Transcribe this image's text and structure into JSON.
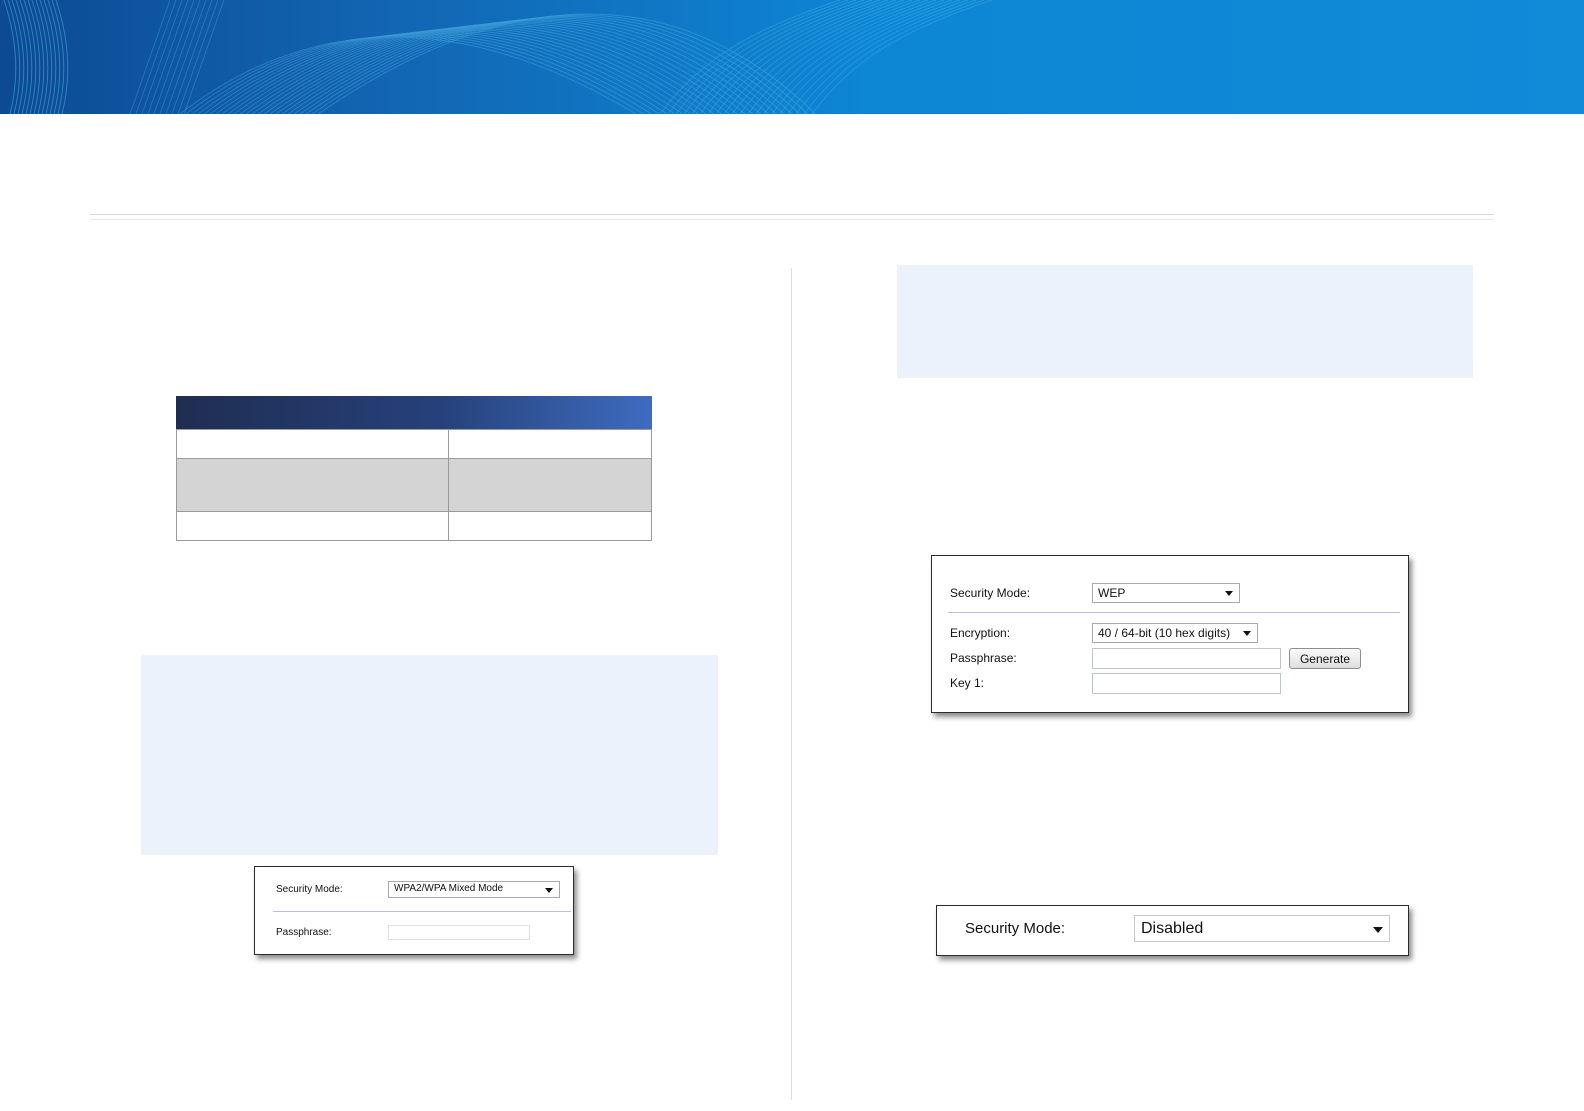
{
  "wpa_mixed_shot": {
    "security_mode_label": "Security Mode:",
    "security_mode_value": "WPA2/WPA Mixed Mode",
    "passphrase_label": "Passphrase:"
  },
  "wep_shot": {
    "security_mode_label": "Security Mode:",
    "security_mode_value": "WEP",
    "encryption_label": "Encryption:",
    "encryption_value": "40 / 64-bit (10 hex digits)",
    "passphrase_label": "Passphrase:",
    "generate_button": "Generate",
    "key1_label": "Key 1:"
  },
  "disabled_shot": {
    "security_mode_label": "Security Mode:",
    "security_mode_value": "Disabled"
  },
  "colors": {
    "banner_dark": "#0c4a93",
    "banner_light": "#0f8bd8",
    "note_background": "#ecf2fb",
    "table_header_dark": "#1f2d52",
    "table_header_light": "#3e6cbf",
    "table_gray_row": "#d4d4d4"
  }
}
